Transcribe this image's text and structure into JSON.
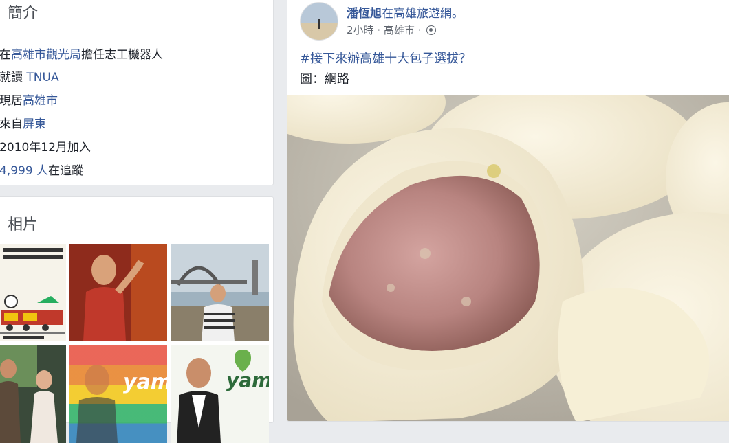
{
  "intro": {
    "title": "簡介",
    "work_prefix": "在",
    "work_link": "高雄市觀光局",
    "work_suffix": "擔任志工機器人",
    "study_prefix": "就讀 ",
    "study_link": "TNUA",
    "lives_prefix": "現居",
    "lives_link": "高雄市",
    "from_prefix": "來自",
    "from_link": "屏東",
    "joined": "2010年12月加入",
    "followers_link": "4,999 人",
    "followers_suffix": "在追蹤"
  },
  "photos": {
    "title": "相片",
    "thumb_texts": [
      "yam",
      "yam"
    ]
  },
  "post": {
    "author": "潘恆旭",
    "author_suffix": "在高雄旅遊網。",
    "time": "2小時",
    "location": "高雄市",
    "hashtag_text": "#接下來辦高雄十大包子選拔？",
    "caption": "圖：網路"
  },
  "colors": {
    "link": "#365899",
    "background": "#e9ebee"
  }
}
